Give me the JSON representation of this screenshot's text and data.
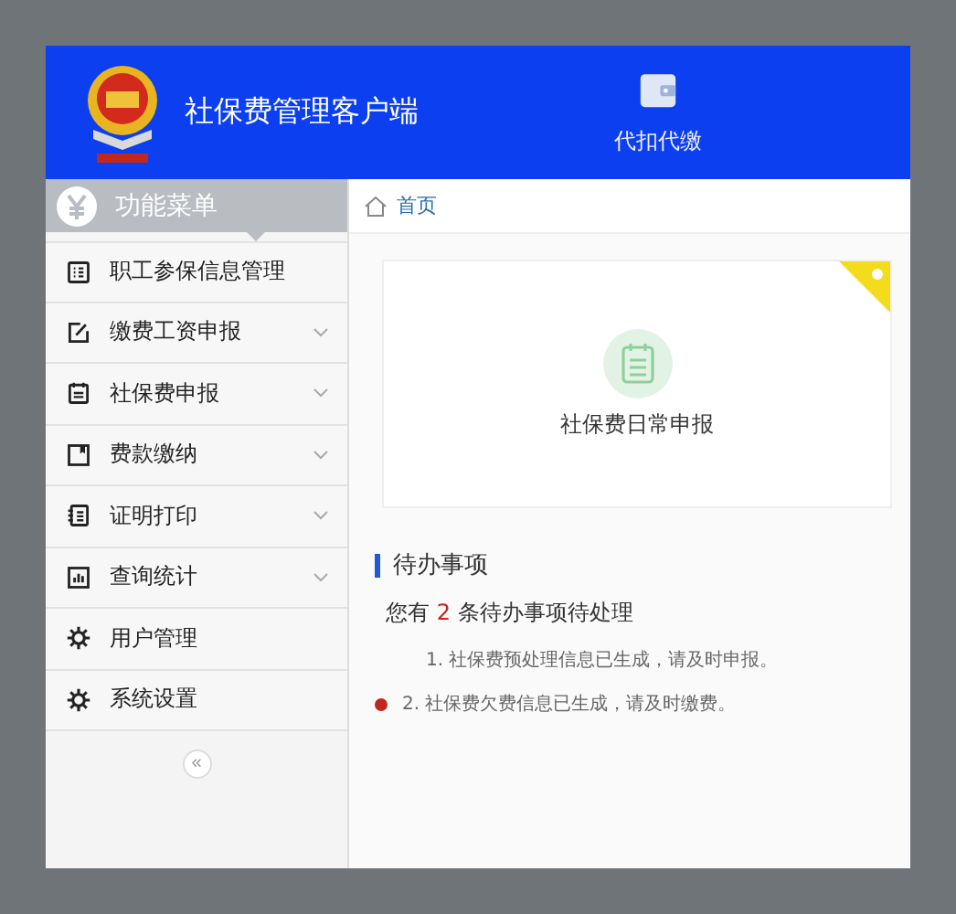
{
  "header": {
    "title": "社保费管理客户端",
    "nav": [
      {
        "label": "代扣代缴"
      }
    ]
  },
  "sidebar": {
    "title": "功能菜单",
    "items": [
      {
        "label": "职工参保信息管理",
        "kind": "list",
        "expandable": false
      },
      {
        "label": "缴费工资申报",
        "kind": "edit",
        "expandable": true
      },
      {
        "label": "社保费申报",
        "kind": "doc",
        "expandable": true
      },
      {
        "label": "费款缴纳",
        "kind": "book",
        "expandable": true
      },
      {
        "label": "证明打印",
        "kind": "notebook",
        "expandable": true
      },
      {
        "label": "查询统计",
        "kind": "chart",
        "expandable": true
      },
      {
        "label": "用户管理",
        "kind": "gear",
        "expandable": false
      },
      {
        "label": "系统设置",
        "kind": "gear",
        "expandable": false
      }
    ],
    "collapse": "«"
  },
  "breadcrumb": "首页",
  "tile": {
    "label": "社保费日常申报"
  },
  "todo": {
    "title": "待办事项",
    "summary": {
      "before": "您有 ",
      "count": "2",
      "after": " 条待办事项待处理"
    },
    "items": [
      {
        "text": "1. 社保费预处理信息已生成，请及时申报。",
        "alert": false
      },
      {
        "text": "2. 社保费欠费信息已生成，请及时缴费。",
        "alert": true
      }
    ]
  }
}
